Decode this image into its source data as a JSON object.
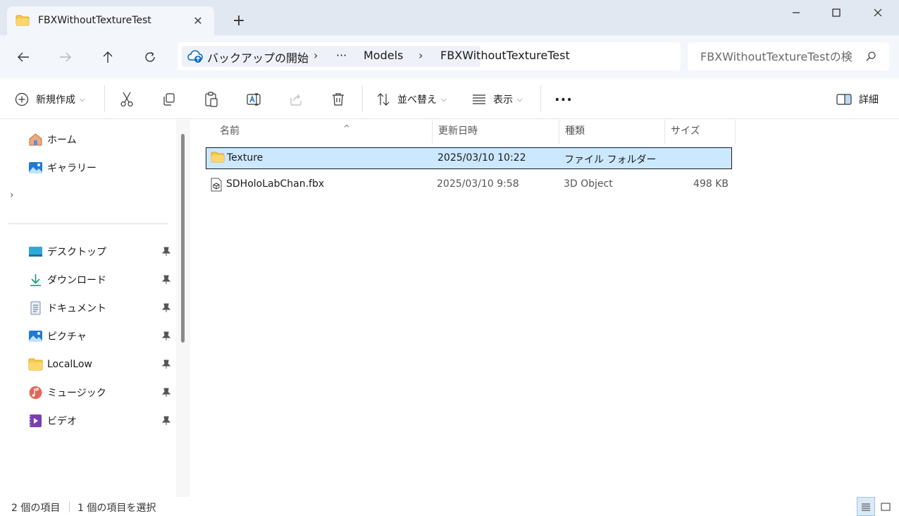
{
  "window": {
    "tab_title": "FBXWithoutTextureTest",
    "tab_close": "✕",
    "new_tab": "+"
  },
  "address": {
    "backup_label": "バックアップの開始",
    "separator": "›",
    "overflow": "···",
    "crumbs": [
      "Models",
      "FBXWithoutTextureTest"
    ]
  },
  "search": {
    "placeholder": "FBXWithoutTextureTestの検"
  },
  "toolbar": {
    "new_label": "新規作成",
    "sort_label": "並べ替え",
    "view_label": "表示",
    "more": "···",
    "details_label": "詳細"
  },
  "sidebar": {
    "top_items": [
      {
        "label": "ホーム",
        "icon": "home-icon"
      },
      {
        "label": "ギャラリー",
        "icon": "gallery-icon"
      }
    ],
    "expander": "›",
    "pinned_items": [
      {
        "label": "デスクトップ",
        "icon": "desktop-icon"
      },
      {
        "label": "ダウンロード",
        "icon": "download-icon"
      },
      {
        "label": "ドキュメント",
        "icon": "document-icon"
      },
      {
        "label": "ピクチャ",
        "icon": "pictures-icon"
      },
      {
        "label": "LocalLow",
        "icon": "folder-icon"
      },
      {
        "label": "ミュージック",
        "icon": "music-icon"
      },
      {
        "label": "ビデオ",
        "icon": "video-icon"
      }
    ]
  },
  "list": {
    "columns": [
      "名前",
      "更新日時",
      "種類",
      "サイズ"
    ],
    "sort_indicator": "^",
    "rows": [
      {
        "name": "Texture",
        "modified": "2025/03/10 10:22",
        "type": "ファイル フォルダー",
        "size": "",
        "selected": true,
        "icon": "folder-icon"
      },
      {
        "name": "SDHoloLabChan.fbx",
        "modified": "2025/03/10 9:58",
        "type": "3D Object",
        "size": "498 KB",
        "selected": false,
        "icon": "3d-object-file-icon"
      }
    ]
  },
  "status": {
    "item_count": "2 個の項目",
    "selection": "1 個の項目を選択"
  },
  "colors": {
    "titlebar_bg": "#e2e8f2",
    "selection_bg": "#cce8ff",
    "folder_yellow": "#f7c948"
  }
}
